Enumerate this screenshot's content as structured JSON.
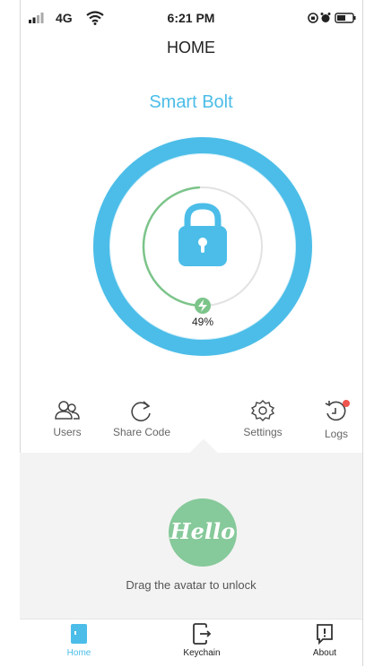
{
  "status_bar": {
    "time": "6:21 PM",
    "network": "4G"
  },
  "header": {
    "title": "HOME"
  },
  "device": {
    "name": "Smart Bolt"
  },
  "battery": {
    "percent_label": "49%",
    "level": 0.49
  },
  "actions": [
    {
      "label": "Users",
      "icon": "users-icon"
    },
    {
      "label": "Share Code",
      "icon": "share-icon"
    },
    {
      "label": "Settings",
      "icon": "gear-icon"
    },
    {
      "label": "Logs",
      "icon": "clock-icon"
    }
  ],
  "unlock": {
    "avatar_text": "Hello",
    "hint": "Drag the avatar to unlock"
  },
  "tabs": [
    {
      "label": "Home",
      "icon": "door-icon",
      "active": true
    },
    {
      "label": "Keychain",
      "icon": "keychain-icon",
      "active": false
    },
    {
      "label": "About",
      "icon": "info-icon",
      "active": false
    }
  ],
  "colors": {
    "accent": "#4bbde8",
    "battery_green": "#7cc48a",
    "avatar_green": "#86c99a",
    "notification": "#f0554e"
  }
}
